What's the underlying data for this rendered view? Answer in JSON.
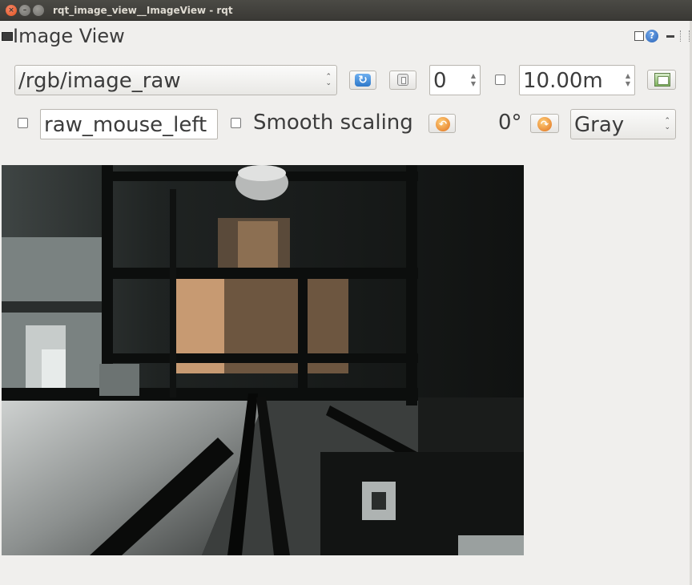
{
  "window": {
    "title": "rqt_image_view__ImageView - rqt",
    "close_glyph": "×",
    "min_glyph": "–"
  },
  "dock": {
    "title": "Image View",
    "help_glyph": "?"
  },
  "toolbar": {
    "topic": "/rgb/image_raw",
    "spin_value": "0",
    "timeout_value": "10.00m",
    "mouse_topic_value": "raw_mouse_left",
    "smooth_scaling_label": "Smooth scaling",
    "rotation_label": "0°",
    "color_scheme": "Gray",
    "combo_arrows": "⌃⌄"
  },
  "colors": {
    "titlebar": "#3c3b37",
    "close_button": "#e9541f",
    "panel_bg": "#f0efed"
  }
}
